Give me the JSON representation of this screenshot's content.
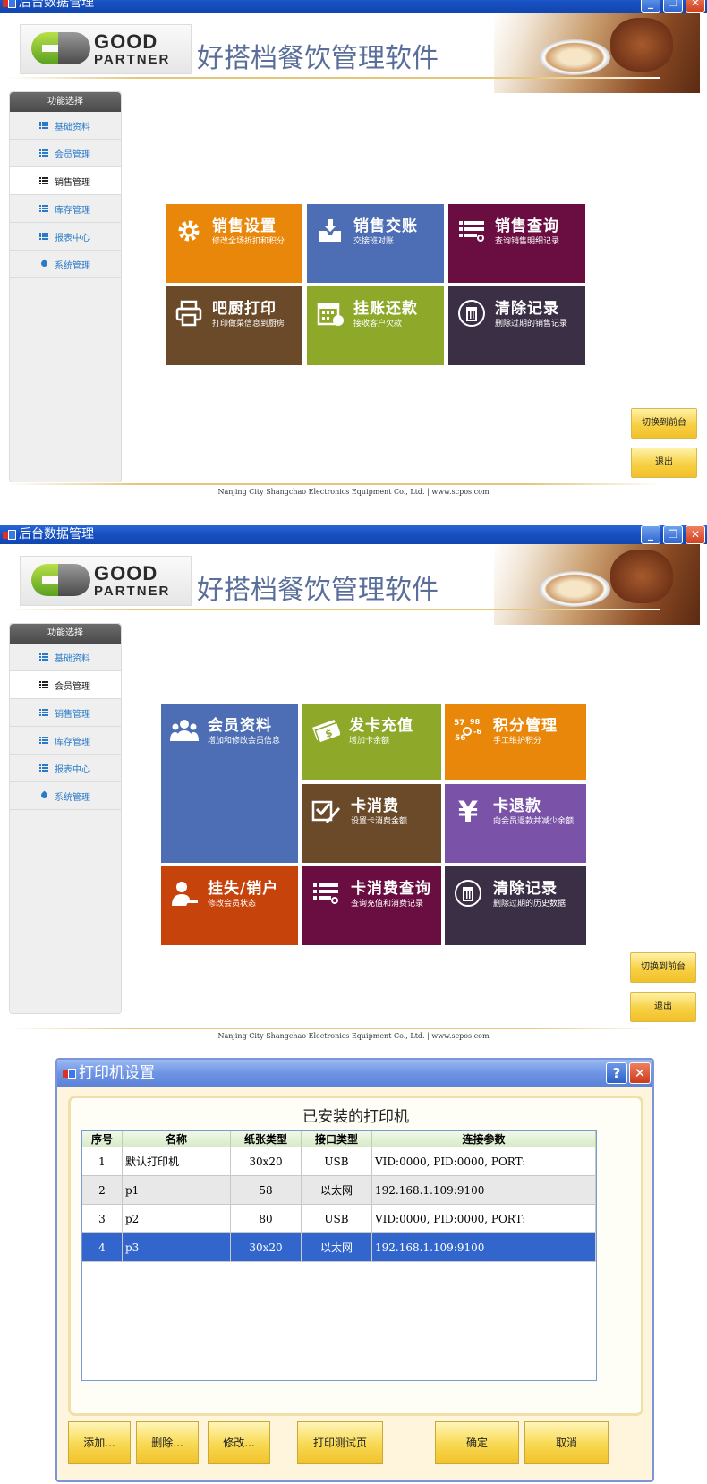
{
  "window1": {
    "title": "后台数据管理",
    "app_name": "好搭档餐饮管理软件",
    "logo": {
      "line1": "GOOD",
      "line2": "PARTNER"
    },
    "sidebar": {
      "header": "功能选择",
      "items": [
        {
          "label": "基础资料",
          "icon": "list-icon"
        },
        {
          "label": "会员管理",
          "icon": "list-icon"
        },
        {
          "label": "销售管理",
          "icon": "list-icon",
          "active": true
        },
        {
          "label": "库存管理",
          "icon": "list-icon"
        },
        {
          "label": "报表中心",
          "icon": "list-icon"
        },
        {
          "label": "系统管理",
          "icon": "drop-icon"
        }
      ]
    },
    "tiles": [
      {
        "title": "销售设置",
        "subtitle": "修改全场折扣和积分",
        "color": "#e8870a",
        "icon": "gear-icon"
      },
      {
        "title": "销售交账",
        "subtitle": "交接班对账",
        "color": "#4d6eb5",
        "icon": "inbox-download-icon"
      },
      {
        "title": "销售查询",
        "subtitle": "查询销售明细记录",
        "color": "#6a0d40",
        "icon": "list-search-icon"
      },
      {
        "title": "吧厨打印",
        "subtitle": "打印做菜信息到厨房",
        "color": "#6b4a2a",
        "icon": "printer-icon"
      },
      {
        "title": "挂账还款",
        "subtitle": "接收客户欠款",
        "color": "#8ea92a",
        "icon": "calendar-money-icon"
      },
      {
        "title": "清除记录",
        "subtitle": "删除过期的销售记录",
        "color": "#3b2f45",
        "icon": "trash-icon"
      }
    ],
    "buttons": {
      "switch": "切换到前台",
      "exit": "退出"
    },
    "footer": "Nanjing City Shangchao Electronics Equipment Co., Ltd. | www.scpos.com"
  },
  "window2": {
    "title": "后台数据管理",
    "app_name": "好搭档餐饮管理软件",
    "logo": {
      "line1": "GOOD",
      "line2": "PARTNER"
    },
    "sidebar": {
      "header": "功能选择",
      "items": [
        {
          "label": "基础资料",
          "icon": "list-icon"
        },
        {
          "label": "会员管理",
          "icon": "list-icon",
          "active": true
        },
        {
          "label": "销售管理",
          "icon": "list-icon"
        },
        {
          "label": "库存管理",
          "icon": "list-icon"
        },
        {
          "label": "报表中心",
          "icon": "list-icon"
        },
        {
          "label": "系统管理",
          "icon": "drop-icon"
        }
      ]
    },
    "tiles": [
      {
        "title": "会员资料",
        "subtitle": "增加和修改会员信息",
        "color": "#4d6eb5",
        "icon": "users-icon"
      },
      {
        "title": "发卡充值",
        "subtitle": "增加卡余额",
        "color": "#8ea92a",
        "icon": "money-card-icon"
      },
      {
        "title": "积分管理",
        "subtitle": "手工维护积分",
        "color": "#e8870a",
        "icon": "points-icon"
      },
      {
        "title": "卡消费",
        "subtitle": "设置卡消费金额",
        "color": "#6b4a2a",
        "icon": "edit-check-icon"
      },
      {
        "title": "卡退款",
        "subtitle": "向会员退款并减少余额",
        "color": "#7a52a8",
        "icon": "yen-icon"
      },
      {
        "title": "挂失/销户",
        "subtitle": "修改会员状态",
        "color": "#c7430c",
        "icon": "user-remove-icon"
      },
      {
        "title": "卡消费查询",
        "subtitle": "查询充值和消费记录",
        "color": "#6a0d40",
        "icon": "list-search-icon"
      },
      {
        "title": "清除记录",
        "subtitle": "删除过期的历史数据",
        "color": "#3b2f45",
        "icon": "trash-icon"
      }
    ],
    "buttons": {
      "switch": "切换到前台",
      "exit": "退出"
    },
    "footer": "Nanjing City Shangchao Electronics Equipment Co., Ltd. | www.scpos.com"
  },
  "printer_dialog": {
    "title": "打印机设置",
    "panel_title": "已安装的打印机",
    "columns": [
      "序号",
      "名称",
      "纸张类型",
      "接口类型",
      "连接参数"
    ],
    "rows": [
      [
        "1",
        "默认打印机",
        "30x20",
        "USB",
        "VID:0000, PID:0000, PORT:"
      ],
      [
        "2",
        "p1",
        "58",
        "以太网",
        "192.168.1.109:9100"
      ],
      [
        "3",
        "p2",
        "80",
        "USB",
        "VID:0000, PID:0000, PORT:"
      ],
      [
        "4",
        "p3",
        "30x20",
        "以太网",
        "192.168.1.109:9100"
      ]
    ],
    "selected_row": 4,
    "buttons": {
      "add": "添加...",
      "delete": "删除...",
      "edit": "修改...",
      "test": "打印测试页",
      "ok": "确定",
      "cancel": "取消"
    }
  }
}
